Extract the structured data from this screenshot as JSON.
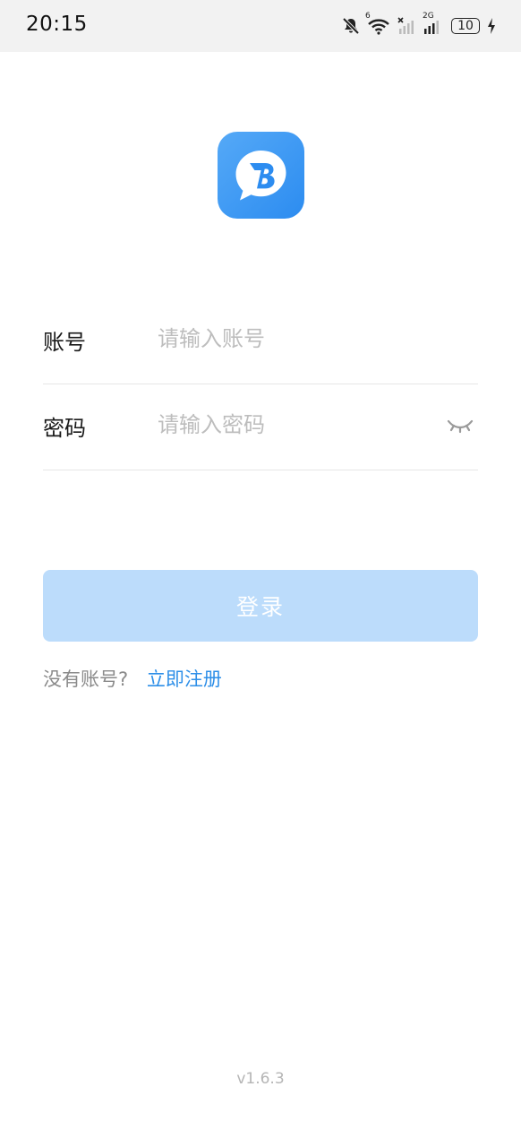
{
  "status_bar": {
    "time": "20:15",
    "battery_level": "10",
    "network_label": "2G",
    "wifi_label": "6",
    "icons": [
      "mute-bell-icon",
      "wifi-icon",
      "signal-icon",
      "signal-2g-icon",
      "battery-icon",
      "charging-icon"
    ]
  },
  "app": {
    "logo_icon": "app-logo-icon",
    "brand_color": "#2c8cf0"
  },
  "form": {
    "account": {
      "label": "账号",
      "placeholder": "请输入账号",
      "value": ""
    },
    "password": {
      "label": "密码",
      "placeholder": "请输入密码",
      "value": "",
      "toggle_icon": "eye-closed-icon"
    },
    "login_label": "登录",
    "login_color": "#bcdcfb"
  },
  "register": {
    "prompt": "没有账号?",
    "link": "立即注册",
    "link_color": "#2e8fe8"
  },
  "version": "v1.6.3"
}
